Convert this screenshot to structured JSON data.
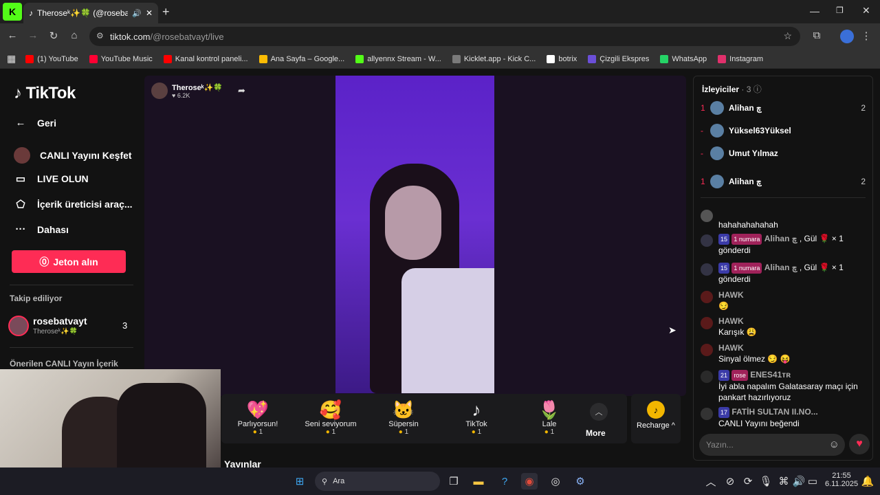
{
  "browser": {
    "tab_title": "Theroseᵏ✨🍀 (@rosebatvaytt",
    "url_host": "tiktok.com",
    "url_path": "/@rosebatvayt/live",
    "bookmarks": [
      {
        "label": "(1) YouTube",
        "color": "#ff0000"
      },
      {
        "label": "YouTube Music",
        "color": "#ff0033"
      },
      {
        "label": "Kanal kontrol paneli...",
        "color": "#ff0000"
      },
      {
        "label": "Ana Sayfa – Google...",
        "color": "#fbbc04"
      },
      {
        "label": "allyennx Stream - W...",
        "color": "#53fc18"
      },
      {
        "label": "Kicklet.app - Kick C...",
        "color": "#7a7a7a"
      },
      {
        "label": "botrix",
        "color": "#ffffff"
      },
      {
        "label": "Çizgili Ekspres",
        "color": "#6b4fd8"
      },
      {
        "label": "WhatsApp",
        "color": "#25d366"
      },
      {
        "label": "Instagram",
        "color": "#e1306c"
      }
    ]
  },
  "sidebar": {
    "logo": "TikTok",
    "back": "Geri",
    "items": [
      {
        "label": "CANLI Yayını Keşfet",
        "icon": "live-explore-icon"
      },
      {
        "label": "LIVE OLUN",
        "icon": "video-camera-icon"
      },
      {
        "label": "İçerik üreticisi araç...",
        "icon": "creator-tools-icon"
      },
      {
        "label": "Dahası",
        "icon": "more-dots-icon"
      }
    ],
    "coins_button": "Jeton alın",
    "following_title": "Takip ediliyor",
    "following_user": "rosebatvayt",
    "following_sub": "Theroseᵏ✨🍀",
    "following_count": "3",
    "suggested_title": "Önerilen CANLI Yayın İçerik"
  },
  "stream": {
    "host_name": "Theroseᵏ✨🍀",
    "likes": "♥ 6.2K",
    "gifts": [
      {
        "name": "Parlıyorsun!",
        "price": "1",
        "emoji": "💖"
      },
      {
        "name": "Seni seviyorum",
        "price": "1",
        "emoji": "🥰"
      },
      {
        "name": "Süpersin",
        "price": "1",
        "emoji": "🐱"
      },
      {
        "name": "TikTok",
        "price": "1",
        "emoji": "♪"
      },
      {
        "name": "Lale",
        "price": "1",
        "emoji": "🌷"
      }
    ],
    "more": "More",
    "recharge": "Recharge ^",
    "section_title": "Yayınlar"
  },
  "viewers": {
    "title": "İzleyiciler",
    "count": "· 3",
    "list": [
      {
        "rank": "1",
        "name": "Alihan چ",
        "score": "2"
      },
      {
        "rank": "-",
        "name": "Yüksel63Yüksel",
        "score": ""
      },
      {
        "rank": "-",
        "name": "Umut Yılmaz",
        "score": ""
      },
      {
        "rank": "1",
        "name": "Alihan چ",
        "score": "2"
      }
    ]
  },
  "chat": [
    {
      "user": "",
      "badge": "",
      "text": "hahahahahahah"
    },
    {
      "user": "Alihan چ",
      "level": "15",
      "badge": "1 numara",
      "text": ", Gül 🌹 × 1 gönderdi"
    },
    {
      "user": "Alihan چ",
      "level": "15",
      "badge": "1 numara",
      "text": ", Gül 🌹 × 1 gönderdi"
    },
    {
      "user": "HAWK",
      "text": "😏"
    },
    {
      "user": "HAWK",
      "text": "Karışık 😩"
    },
    {
      "user": "HAWK",
      "text": "Sinyal ölmez 😏 😝"
    },
    {
      "user": "ENES41ᴛʀ",
      "level": "21",
      "badge": "rose",
      "text": "İyi abla napalım Galatasaray maçı için pankart hazırlıyoruz"
    },
    {
      "user": "FATİH SULTAN II.NO...",
      "level": "17",
      "text": "CANLI Yayını beğendi"
    }
  ],
  "chat_input_placeholder": "Yazın...",
  "taskbar": {
    "search": "Ara",
    "time": "21:55",
    "date": "6.11.2025"
  }
}
